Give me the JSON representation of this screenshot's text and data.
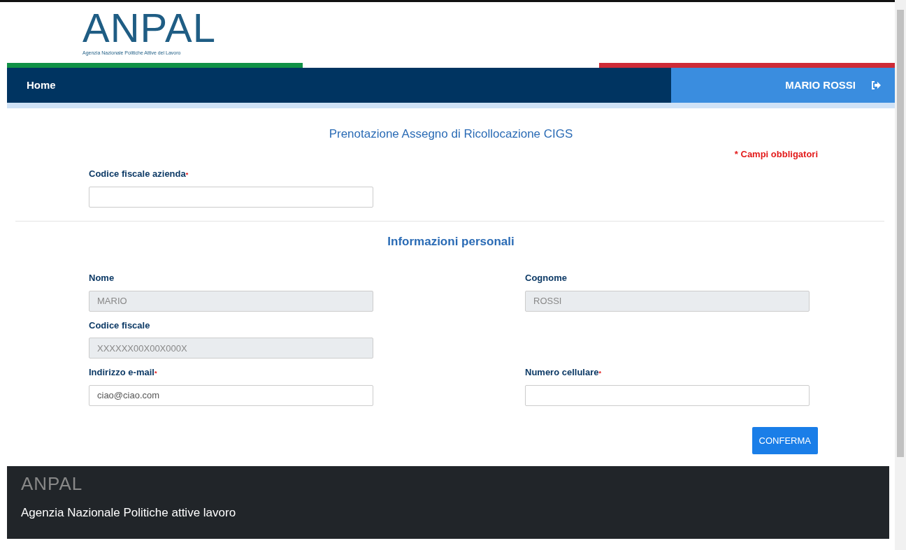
{
  "header": {
    "logo": "ANPAL",
    "tagline": "Agenzia Nazionale Politiche Attive del Lavoro"
  },
  "navbar": {
    "home": "Home",
    "user": "MARIO ROSSI"
  },
  "form": {
    "title": "Prenotazione Assegno di Ricollocazione CIGS",
    "required_note": "* Campi obbligatori",
    "company_field": {
      "label": "Codice fiscale azienda",
      "required_mark": "*",
      "disabled": false
    },
    "section_title": "Informazioni personali",
    "rows": [
      [
        {
          "label": "Nome",
          "value": "MARIO",
          "disabled": true
        },
        {
          "label": "Cognome",
          "value": "ROSSI",
          "disabled": true
        }
      ],
      [
        {
          "label": "Codice fiscale",
          "value": "XXXXXX00X00X000X",
          "disabled": true
        }
      ],
      [
        {
          "label": "Indirizzo e-mail",
          "required_mark": "*",
          "value": "ciao@ciao.com",
          "disabled": false
        },
        {
          "label": "Numero cellulare",
          "required_mark": "*",
          "disabled": false
        }
      ]
    ],
    "submit": "CONFERMA"
  },
  "footer": {
    "logo": "ANPAL",
    "text": "Agenzia Nazionale Politiche attive lavoro"
  }
}
